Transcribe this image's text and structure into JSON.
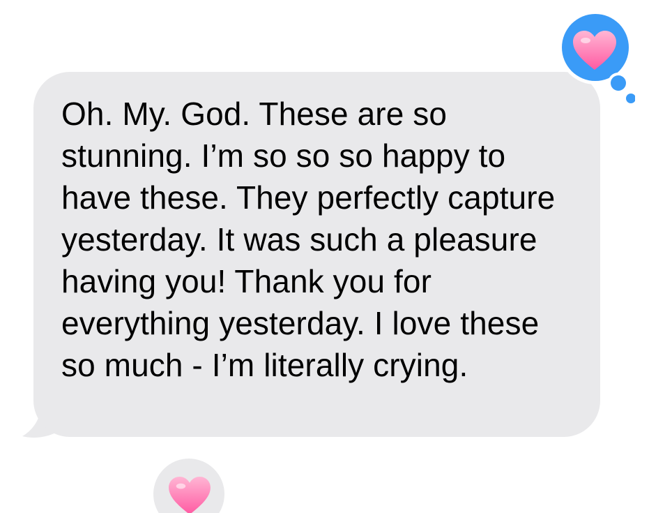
{
  "message": {
    "text": "Oh. My. God. These are so stunning. I’m so so so happy to have these. They perfectly capture yesterday. It was such a pleasure having you! Thank you for everything yesterday. I love these so much - I’m literally crying.",
    "bubble_color": "#e9e9eb",
    "text_color": "#000000"
  },
  "reaction": {
    "icon": "pink-heart-icon",
    "badge_color": "#3a9bf7",
    "emoji_color": "#ff7fb6"
  },
  "next_message_reaction": {
    "icon": "pink-heart-icon",
    "badge_color": "#e9e9eb"
  }
}
